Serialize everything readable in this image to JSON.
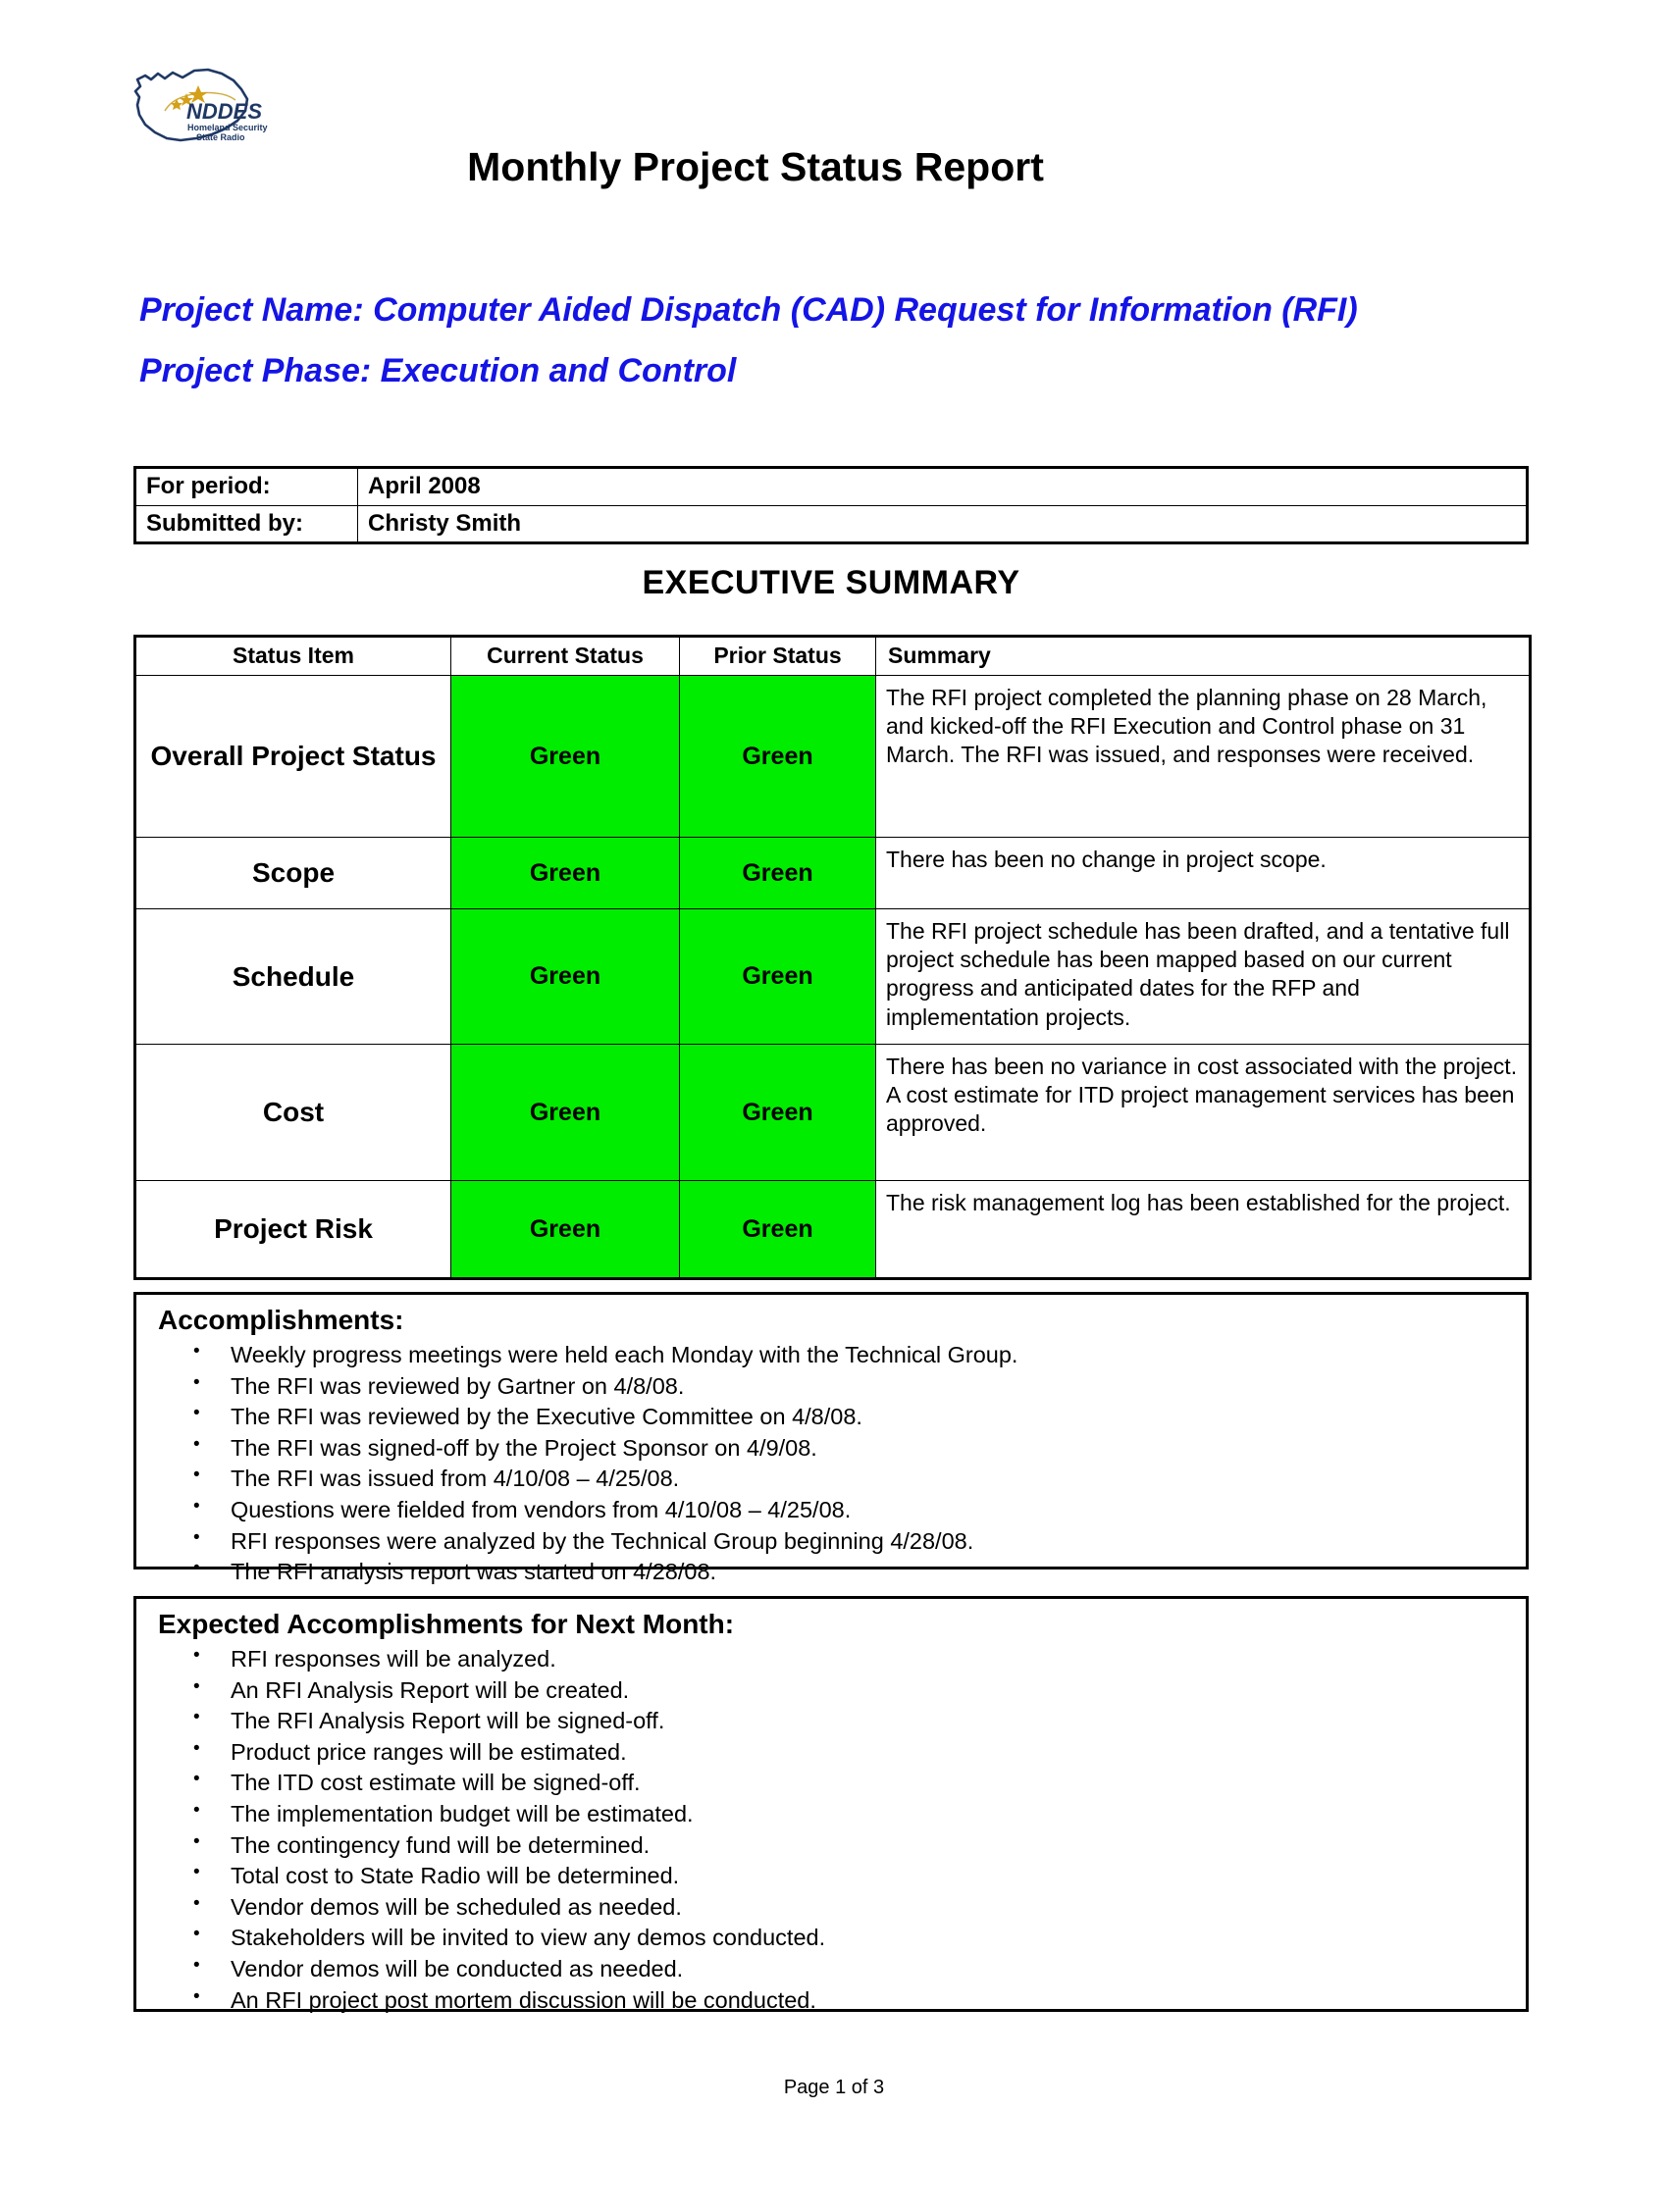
{
  "header": {
    "title": "Monthly Project Status Report",
    "logo_name": "nddes-logo",
    "logo_text": "NDDES",
    "logo_sub1": "Homeland Security",
    "logo_sub2": "State Radio"
  },
  "project": {
    "name_line": "Project Name: Computer Aided Dispatch (CAD) Request for Information (RFI)",
    "phase_line": "Project Phase: Execution and Control",
    "accent_color": "#1414E6"
  },
  "period_table": {
    "rows": [
      {
        "label": "For period:",
        "value": "April 2008"
      },
      {
        "label": "Submitted by:",
        "value": "Christy Smith"
      }
    ]
  },
  "exec_summary": {
    "heading": "EXECUTIVE SUMMARY",
    "columns": [
      "Status Item",
      "Current Status",
      "Prior Status",
      "Summary"
    ],
    "status_green_color": "#00ED00",
    "rows": [
      {
        "item": "Overall Project Status",
        "current": "Green",
        "prior": "Green",
        "summary": "The RFI project completed the planning phase on 28 March, and kicked-off the RFI Execution and Control phase on 31 March.  The RFI was issued, and responses were received."
      },
      {
        "item": "Scope",
        "current": "Green",
        "prior": "Green",
        "summary": "There has been no change in project scope."
      },
      {
        "item": "Schedule",
        "current": "Green",
        "prior": "Green",
        "summary": "The RFI project schedule has been drafted, and a tentative full project schedule has been mapped based on our current progress and anticipated dates for the RFP and implementation projects."
      },
      {
        "item": "Cost",
        "current": "Green",
        "prior": "Green",
        "summary": "There has been no variance in cost associated with the project.  A cost estimate for ITD project management services has been approved."
      },
      {
        "item": "Project Risk",
        "current": "Green",
        "prior": "Green",
        "summary": "The risk management log has been established for the project."
      }
    ]
  },
  "accomplishments": {
    "title": "Accomplishments:",
    "items": [
      "Weekly progress meetings were held each Monday with the Technical Group.",
      "The RFI was reviewed by Gartner on 4/8/08.",
      "The RFI was reviewed by the Executive Committee on 4/8/08.",
      "The RFI was signed-off by the Project Sponsor on 4/9/08.",
      "The RFI was issued from 4/10/08 – 4/25/08.",
      "Questions were fielded from vendors from 4/10/08 – 4/25/08.",
      "RFI responses were analyzed by the Technical Group beginning 4/28/08.",
      "The RFI analysis report was started on 4/28/08."
    ]
  },
  "expected": {
    "title": "Expected Accomplishments for Next Month:",
    "items": [
      "RFI responses will be analyzed.",
      "An RFI Analysis Report will be created.",
      "The RFI Analysis Report will be signed-off.",
      "Product price ranges will be estimated.",
      "The ITD cost estimate will be signed-off.",
      "The implementation budget will be estimated.",
      "The contingency fund will be determined.",
      "Total cost to State Radio will be determined.",
      "Vendor demos will be scheduled as needed.",
      "Stakeholders will be invited to view any demos conducted.",
      "Vendor demos will be conducted as needed.",
      "An RFI project post mortem discussion will be conducted."
    ]
  },
  "footer": {
    "page_label": "Page 1 of 3"
  }
}
